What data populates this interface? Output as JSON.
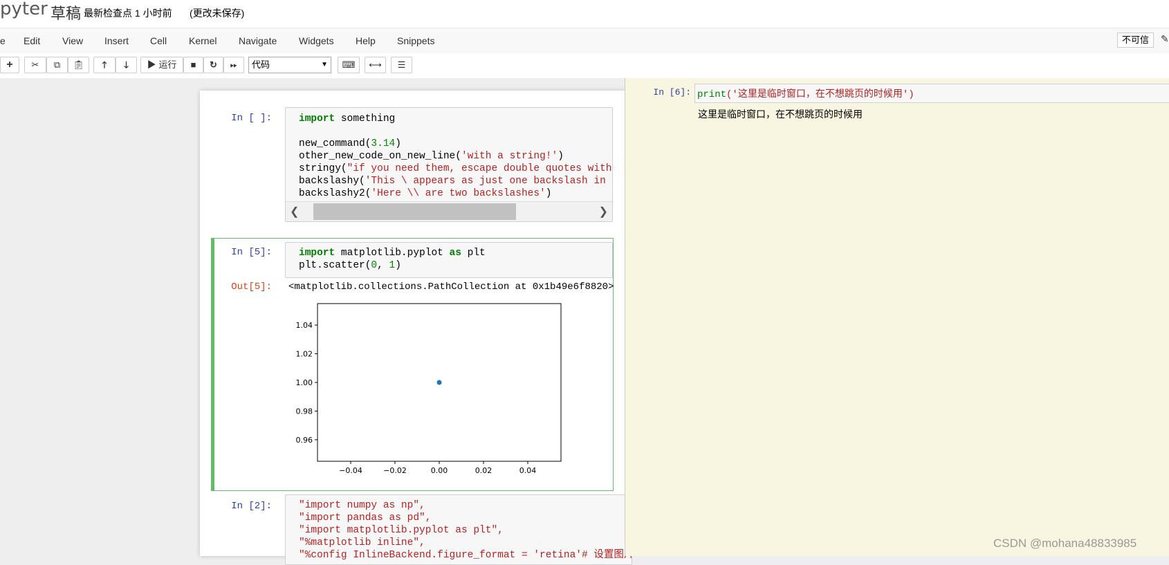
{
  "header": {
    "logo_text": "pyter",
    "notebook_title": "草稿",
    "checkpoint": "最新检查点 1 小时前",
    "autosave_status": "(更改未保存)"
  },
  "menubar": {
    "items": [
      "e",
      "Edit",
      "View",
      "Insert",
      "Cell",
      "Kernel",
      "Navigate",
      "Widgets",
      "Help",
      "Snippets"
    ],
    "trusted": "不可信"
  },
  "toolbar": {
    "run_label": "运行",
    "cell_type": "代码"
  },
  "cells": [
    {
      "prompt": "In [ ]:",
      "lines": [
        "import something",
        "",
        "new_command(3.14)",
        "other_new_code_on_new_line('with a string!')",
        "stringy(\"if you need them, escape double quotes with a si",
        "backslashy('This \\ appears as just one backslash in the c",
        "backslashy2('Here \\\\ are two backslashes')"
      ]
    },
    {
      "prompt": "In [5]:",
      "lines": [
        "import matplotlib.pyplot as plt",
        "plt.scatter(0, 1)"
      ],
      "out_prompt": "Out[5]:",
      "output_text": "<matplotlib.collections.PathCollection at 0x1b49e6f8820>"
    },
    {
      "prompt": "In [2]:",
      "lines": [
        "\"import numpy as np\",",
        "\"import pandas as pd\",",
        "\"import matplotlib.pyplot as plt\",",
        "\"%matplotlib inline\",",
        "\"%config InlineBackend.figure_format = 'retina'# 设置图片清晰"
      ]
    }
  ],
  "scratchpad": {
    "prompt": "In [6]:",
    "code_fn": "print",
    "code_str": "('这里是临时窗口，在不想跳页的时候用')",
    "output": "这里是临时窗口，在不想跳页的时候用"
  },
  "chart_data": {
    "type": "scatter",
    "series": [
      {
        "x": [
          0.0
        ],
        "y": [
          1.0
        ]
      }
    ],
    "xlim": [
      -0.055,
      0.055
    ],
    "ylim": [
      0.945,
      1.055
    ],
    "xticks": [
      -0.04,
      -0.02,
      0.0,
      0.02,
      0.04
    ],
    "yticks": [
      0.96,
      0.98,
      1.0,
      1.02,
      1.04
    ],
    "xtick_labels": [
      "−0.04",
      "−0.02",
      "0.00",
      "0.02",
      "0.04"
    ],
    "ytick_labels": [
      "0.96",
      "0.98",
      "1.00",
      "1.02",
      "1.04"
    ],
    "marker_color": "#1f77b4",
    "title": "",
    "xlabel": "",
    "ylabel": ""
  },
  "watermark": "CSDN @mohana48833985"
}
